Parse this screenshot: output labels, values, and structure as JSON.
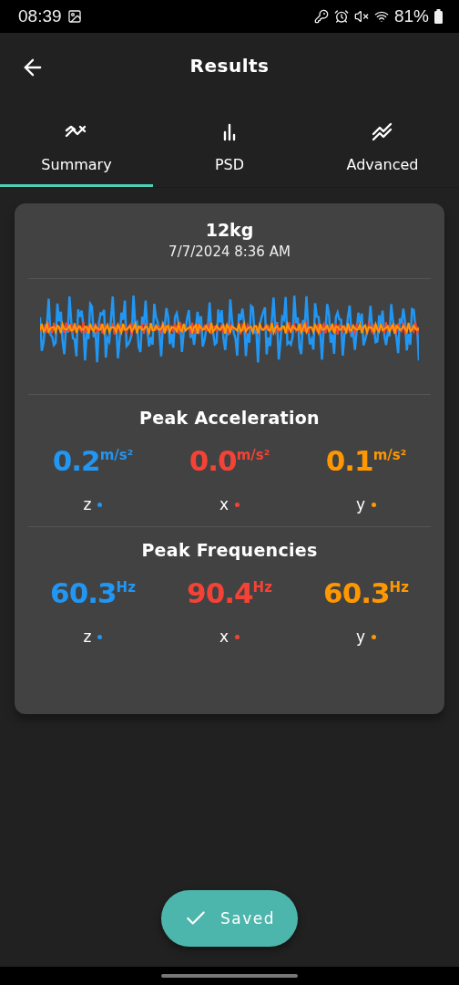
{
  "status_bar": {
    "time": "08:39",
    "battery": "81%"
  },
  "header": {
    "title": "Results"
  },
  "tabs": [
    {
      "label": "Summary",
      "kind": "trend",
      "selected": true
    },
    {
      "label": "PSD",
      "kind": "bars",
      "selected": false
    },
    {
      "label": "Advanced",
      "kind": "zigzag",
      "selected": false
    }
  ],
  "card": {
    "title": "12kg",
    "timestamp": "7/7/2024 8:36 AM",
    "sections": [
      {
        "title": "Peak Acceleration",
        "readings": [
          {
            "value": "0.2",
            "unit": "m/s²",
            "axis": "z",
            "color": "#2196f3"
          },
          {
            "value": "0.0",
            "unit": "m/s²",
            "axis": "x",
            "color": "#f44336"
          },
          {
            "value": "0.1",
            "unit": "m/s²",
            "axis": "y",
            "color": "#ff9800"
          }
        ]
      },
      {
        "title": "Peak Frequencies",
        "readings": [
          {
            "value": "60.3",
            "unit": "Hz",
            "axis": "z",
            "color": "#2196f3"
          },
          {
            "value": "90.4",
            "unit": "Hz",
            "axis": "x",
            "color": "#f44336"
          },
          {
            "value": "60.3",
            "unit": "Hz",
            "axis": "y",
            "color": "#ff9800"
          }
        ]
      }
    ]
  },
  "save_button": {
    "label": "Saved"
  }
}
